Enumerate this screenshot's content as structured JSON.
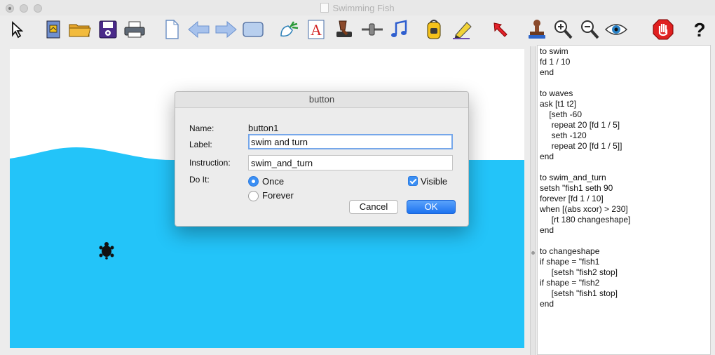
{
  "window": {
    "title": "Swimming Fish"
  },
  "toolbar": {
    "tools": [
      {
        "name": "select-tool-icon"
      },
      {
        "name": "project-icon"
      },
      {
        "name": "open-folder-icon"
      },
      {
        "name": "save-disk-icon"
      },
      {
        "name": "print-icon"
      },
      {
        "name": "new-page-icon"
      },
      {
        "name": "back-arrow-icon"
      },
      {
        "name": "forward-arrow-icon"
      },
      {
        "name": "presentation-icon"
      },
      {
        "name": "new-turtle-icon"
      },
      {
        "name": "text-box-icon"
      },
      {
        "name": "button-tool-icon"
      },
      {
        "name": "slider-tool-icon"
      },
      {
        "name": "music-icon"
      },
      {
        "name": "backpack-icon"
      },
      {
        "name": "pencil-icon"
      },
      {
        "name": "pointer-arrow-icon"
      },
      {
        "name": "stamp-icon"
      },
      {
        "name": "zoom-in-icon"
      },
      {
        "name": "zoom-out-icon"
      },
      {
        "name": "eye-icon"
      },
      {
        "name": "stop-icon"
      },
      {
        "name": "help-icon"
      }
    ]
  },
  "dialog": {
    "title": "button",
    "name_label": "Name:",
    "name_value": "button1",
    "label_label": "Label:",
    "label_value": "swim and turn",
    "instruction_label": "Instruction:",
    "instruction_value": "swim_and_turn",
    "doit_label": "Do It:",
    "once_label": "Once",
    "forever_label": "Forever",
    "visible_label": "Visible",
    "cancel_label": "Cancel",
    "ok_label": "OK",
    "once_selected": true,
    "visible_checked": true
  },
  "code": "to swim\nfd 1 / 10\nend\n\nto waves\nask [t1 t2]\n    [seth -60\n     repeat 20 [fd 1 / 5]\n     seth -120\n     repeat 20 [fd 1 / 5]]\nend\n\nto swim_and_turn\nsetsh \"fish1 seth 90\nforever [fd 1 / 10]\nwhen [(abs xcor) > 230]\n     [rt 180 changeshape]\nend\n\nto changeshape\nif shape = \"fish1\n     [setsh \"fish2 stop]\nif shape = \"fish2\n     [setsh \"fish1 stop]\nend",
  "colors": {
    "water": "#23c4f9",
    "accent": "#3b8ff4"
  }
}
